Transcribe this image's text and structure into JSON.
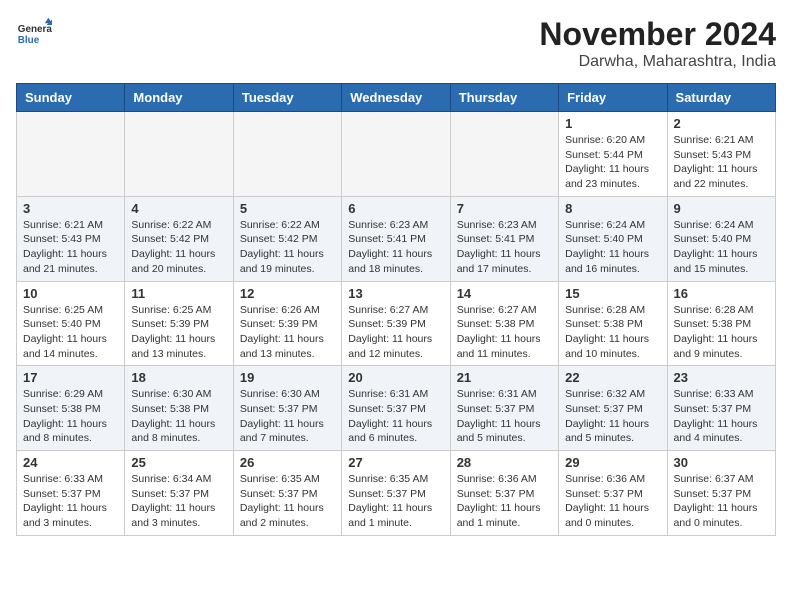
{
  "header": {
    "logo_line1": "General",
    "logo_line2": "Blue",
    "month": "November 2024",
    "location": "Darwha, Maharashtra, India"
  },
  "weekdays": [
    "Sunday",
    "Monday",
    "Tuesday",
    "Wednesday",
    "Thursday",
    "Friday",
    "Saturday"
  ],
  "weeks": [
    [
      {
        "day": "",
        "empty": true
      },
      {
        "day": "",
        "empty": true
      },
      {
        "day": "",
        "empty": true
      },
      {
        "day": "",
        "empty": true
      },
      {
        "day": "",
        "empty": true
      },
      {
        "day": "1",
        "sunrise": "Sunrise: 6:20 AM",
        "sunset": "Sunset: 5:44 PM",
        "daylight": "Daylight: 11 hours and 23 minutes."
      },
      {
        "day": "2",
        "sunrise": "Sunrise: 6:21 AM",
        "sunset": "Sunset: 5:43 PM",
        "daylight": "Daylight: 11 hours and 22 minutes."
      }
    ],
    [
      {
        "day": "3",
        "sunrise": "Sunrise: 6:21 AM",
        "sunset": "Sunset: 5:43 PM",
        "daylight": "Daylight: 11 hours and 21 minutes."
      },
      {
        "day": "4",
        "sunrise": "Sunrise: 6:22 AM",
        "sunset": "Sunset: 5:42 PM",
        "daylight": "Daylight: 11 hours and 20 minutes."
      },
      {
        "day": "5",
        "sunrise": "Sunrise: 6:22 AM",
        "sunset": "Sunset: 5:42 PM",
        "daylight": "Daylight: 11 hours and 19 minutes."
      },
      {
        "day": "6",
        "sunrise": "Sunrise: 6:23 AM",
        "sunset": "Sunset: 5:41 PM",
        "daylight": "Daylight: 11 hours and 18 minutes."
      },
      {
        "day": "7",
        "sunrise": "Sunrise: 6:23 AM",
        "sunset": "Sunset: 5:41 PM",
        "daylight": "Daylight: 11 hours and 17 minutes."
      },
      {
        "day": "8",
        "sunrise": "Sunrise: 6:24 AM",
        "sunset": "Sunset: 5:40 PM",
        "daylight": "Daylight: 11 hours and 16 minutes."
      },
      {
        "day": "9",
        "sunrise": "Sunrise: 6:24 AM",
        "sunset": "Sunset: 5:40 PM",
        "daylight": "Daylight: 11 hours and 15 minutes."
      }
    ],
    [
      {
        "day": "10",
        "sunrise": "Sunrise: 6:25 AM",
        "sunset": "Sunset: 5:40 PM",
        "daylight": "Daylight: 11 hours and 14 minutes."
      },
      {
        "day": "11",
        "sunrise": "Sunrise: 6:25 AM",
        "sunset": "Sunset: 5:39 PM",
        "daylight": "Daylight: 11 hours and 13 minutes."
      },
      {
        "day": "12",
        "sunrise": "Sunrise: 6:26 AM",
        "sunset": "Sunset: 5:39 PM",
        "daylight": "Daylight: 11 hours and 13 minutes."
      },
      {
        "day": "13",
        "sunrise": "Sunrise: 6:27 AM",
        "sunset": "Sunset: 5:39 PM",
        "daylight": "Daylight: 11 hours and 12 minutes."
      },
      {
        "day": "14",
        "sunrise": "Sunrise: 6:27 AM",
        "sunset": "Sunset: 5:38 PM",
        "daylight": "Daylight: 11 hours and 11 minutes."
      },
      {
        "day": "15",
        "sunrise": "Sunrise: 6:28 AM",
        "sunset": "Sunset: 5:38 PM",
        "daylight": "Daylight: 11 hours and 10 minutes."
      },
      {
        "day": "16",
        "sunrise": "Sunrise: 6:28 AM",
        "sunset": "Sunset: 5:38 PM",
        "daylight": "Daylight: 11 hours and 9 minutes."
      }
    ],
    [
      {
        "day": "17",
        "sunrise": "Sunrise: 6:29 AM",
        "sunset": "Sunset: 5:38 PM",
        "daylight": "Daylight: 11 hours and 8 minutes."
      },
      {
        "day": "18",
        "sunrise": "Sunrise: 6:30 AM",
        "sunset": "Sunset: 5:38 PM",
        "daylight": "Daylight: 11 hours and 8 minutes."
      },
      {
        "day": "19",
        "sunrise": "Sunrise: 6:30 AM",
        "sunset": "Sunset: 5:37 PM",
        "daylight": "Daylight: 11 hours and 7 minutes."
      },
      {
        "day": "20",
        "sunrise": "Sunrise: 6:31 AM",
        "sunset": "Sunset: 5:37 PM",
        "daylight": "Daylight: 11 hours and 6 minutes."
      },
      {
        "day": "21",
        "sunrise": "Sunrise: 6:31 AM",
        "sunset": "Sunset: 5:37 PM",
        "daylight": "Daylight: 11 hours and 5 minutes."
      },
      {
        "day": "22",
        "sunrise": "Sunrise: 6:32 AM",
        "sunset": "Sunset: 5:37 PM",
        "daylight": "Daylight: 11 hours and 5 minutes."
      },
      {
        "day": "23",
        "sunrise": "Sunrise: 6:33 AM",
        "sunset": "Sunset: 5:37 PM",
        "daylight": "Daylight: 11 hours and 4 minutes."
      }
    ],
    [
      {
        "day": "24",
        "sunrise": "Sunrise: 6:33 AM",
        "sunset": "Sunset: 5:37 PM",
        "daylight": "Daylight: 11 hours and 3 minutes."
      },
      {
        "day": "25",
        "sunrise": "Sunrise: 6:34 AM",
        "sunset": "Sunset: 5:37 PM",
        "daylight": "Daylight: 11 hours and 3 minutes."
      },
      {
        "day": "26",
        "sunrise": "Sunrise: 6:35 AM",
        "sunset": "Sunset: 5:37 PM",
        "daylight": "Daylight: 11 hours and 2 minutes."
      },
      {
        "day": "27",
        "sunrise": "Sunrise: 6:35 AM",
        "sunset": "Sunset: 5:37 PM",
        "daylight": "Daylight: 11 hours and 1 minute."
      },
      {
        "day": "28",
        "sunrise": "Sunrise: 6:36 AM",
        "sunset": "Sunset: 5:37 PM",
        "daylight": "Daylight: 11 hours and 1 minute."
      },
      {
        "day": "29",
        "sunrise": "Sunrise: 6:36 AM",
        "sunset": "Sunset: 5:37 PM",
        "daylight": "Daylight: 11 hours and 0 minutes."
      },
      {
        "day": "30",
        "sunrise": "Sunrise: 6:37 AM",
        "sunset": "Sunset: 5:37 PM",
        "daylight": "Daylight: 11 hours and 0 minutes."
      }
    ]
  ]
}
